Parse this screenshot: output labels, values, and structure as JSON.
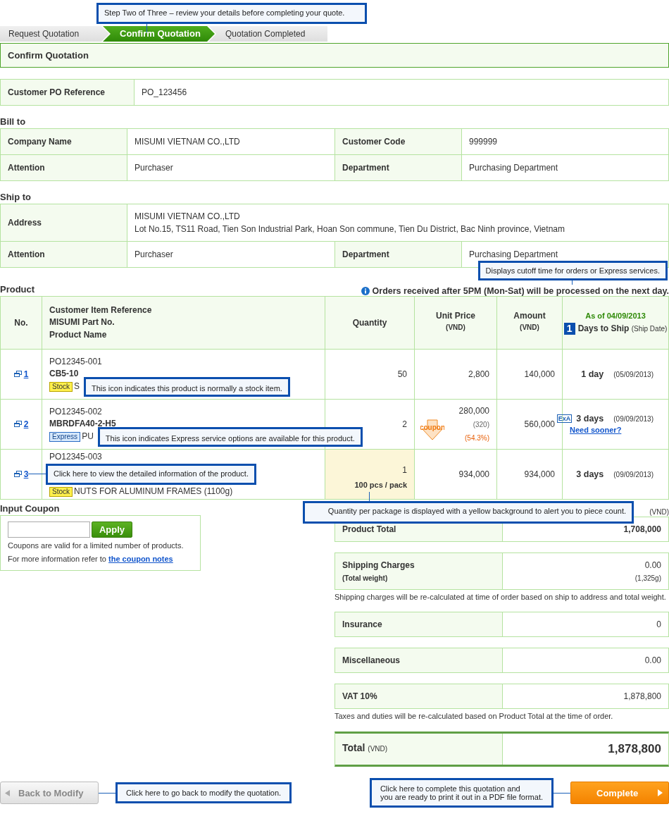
{
  "steps_tooltip": "Step Two of Three – review your details before completing your quote.",
  "steps": [
    {
      "label": "Request Quotation",
      "selected": false
    },
    {
      "label": "Confirm Quotation",
      "selected": true
    },
    {
      "label": "Quotation Completed",
      "selected": false
    }
  ],
  "page_title": "Confirm Quotation",
  "po": {
    "label": "Customer PO Reference",
    "value": "PO_123456"
  },
  "bill_to": {
    "heading": "Bill to",
    "fields": [
      {
        "label": "Company Name",
        "value": "MISUMI VIETNAM CO.,LTD"
      },
      {
        "label": "Customer Code",
        "value": "999999"
      },
      {
        "label": "Attention",
        "value": "Purchaser"
      },
      {
        "label": "Department",
        "value": "Purchasing Department"
      }
    ]
  },
  "ship_to": {
    "heading": "Ship to",
    "address": {
      "label": "Address",
      "lines": [
        "MISUMI VIETNAM CO.,LTD",
        "Lot No.15, TS11 Road, Tien Son Industrial Park, Hoan Son commune, Tien Du District, Bac Ninh province, Vietnam"
      ]
    },
    "fields": [
      {
        "label": "Attention",
        "value": "Purchaser"
      },
      {
        "label": "Department",
        "value": "Purchasing Department"
      }
    ]
  },
  "product": {
    "heading": "Product",
    "notice": "Orders received after 5PM (Mon-Sat) will be processed on the next day.",
    "notice_callout": "Displays cutoff time for orders or Express services.",
    "columns": [
      {
        "label": "No."
      },
      {
        "lines": [
          "Customer Item Reference",
          "MISUMI Part No.",
          "Product Name"
        ]
      },
      {
        "label": "Quantity"
      },
      {
        "label": "Unit Price",
        "unit": "(VND)"
      },
      {
        "label": "Amount",
        "unit": "(VND)"
      },
      {
        "label": "Days to Ship",
        "note": "(Ship Date)",
        "as_of": "As of 04/09/2013",
        "marker": "1"
      }
    ],
    "rows": [
      {
        "no": "1",
        "reference": "PO12345-001",
        "part_no": "CB5-10",
        "badge": {
          "kind": "stock",
          "label": "Stock"
        },
        "name": "S",
        "quantity": "50",
        "unit_price": "2,800",
        "amount": "140,000",
        "days": "1 day",
        "ship_date": "(05/09/2013)",
        "callout": "This icon indicates this product is normally a stock item."
      },
      {
        "no": "2",
        "reference": "PO12345-002",
        "part_no": "MBRDFA40-2-H5",
        "badge": {
          "kind": "express",
          "label": "Express"
        },
        "name": "PU",
        "quantity": "2",
        "unit_price": "280,000",
        "coupon": {
          "label": "coupon",
          "original": "(320)",
          "discount": "(54.3%)"
        },
        "amount": "560,000",
        "express": {
          "label": "ExA"
        },
        "days": "3 days",
        "ship_date": "(09/09/2013)",
        "link": "Need sooner?",
        "callout": "This icon indicates Express service options are available for this product."
      },
      {
        "no": "3",
        "reference": "PO12345-003",
        "badge": {
          "kind": "stock",
          "label": "Stock"
        },
        "name": "NUTS FOR ALUMINUM FRAMES (1100g)",
        "quantity": "1",
        "pack": "100 pcs / pack",
        "pack_callout": "Quantity per package is displayed with a yellow background to alert you to piece count.",
        "unit_price": "934,000",
        "amount": "934,000",
        "days": "3 days",
        "ship_date": "(09/09/2013)",
        "number_callout": "Click here to view the detailed information of the product."
      }
    ]
  },
  "coupon": {
    "heading": "Input Coupon",
    "button": "Apply",
    "note": "Coupons are valid for a limited number of products.",
    "more": "For more information refer to",
    "link": "the coupon notes"
  },
  "totals": {
    "currency": "(VND)",
    "items": [
      {
        "kind": "line",
        "label": "Product Total",
        "value": "1,708,000",
        "bold": true
      },
      {
        "kind": "line",
        "label": "Shipping Charges",
        "sub_label": "(Total weight)",
        "value": "0.00",
        "sub_value": "(1,325g)",
        "note": "Shipping charges will be re-calculated at time of order based on ship to address and total weight."
      },
      {
        "kind": "line",
        "label": "Insurance",
        "value": "0"
      },
      {
        "kind": "line",
        "label": "Miscellaneous",
        "value": "0.00"
      },
      {
        "kind": "line",
        "label": "VAT 10%",
        "value": "1,878,800",
        "note": "Taxes and duties will be re-calculated based on Product Total at the time of order."
      },
      {
        "kind": "grand",
        "label": "Total",
        "unit": "(VND)",
        "value": "1,878,800"
      }
    ]
  },
  "actions": {
    "back": {
      "label": "Back to Modify",
      "callout": "Click here to go back to modify the quotation."
    },
    "complete": {
      "label": "Complete",
      "callout": [
        "Click here to complete this quotation and",
        "you are ready to print it out in a PDF file format."
      ]
    }
  }
}
